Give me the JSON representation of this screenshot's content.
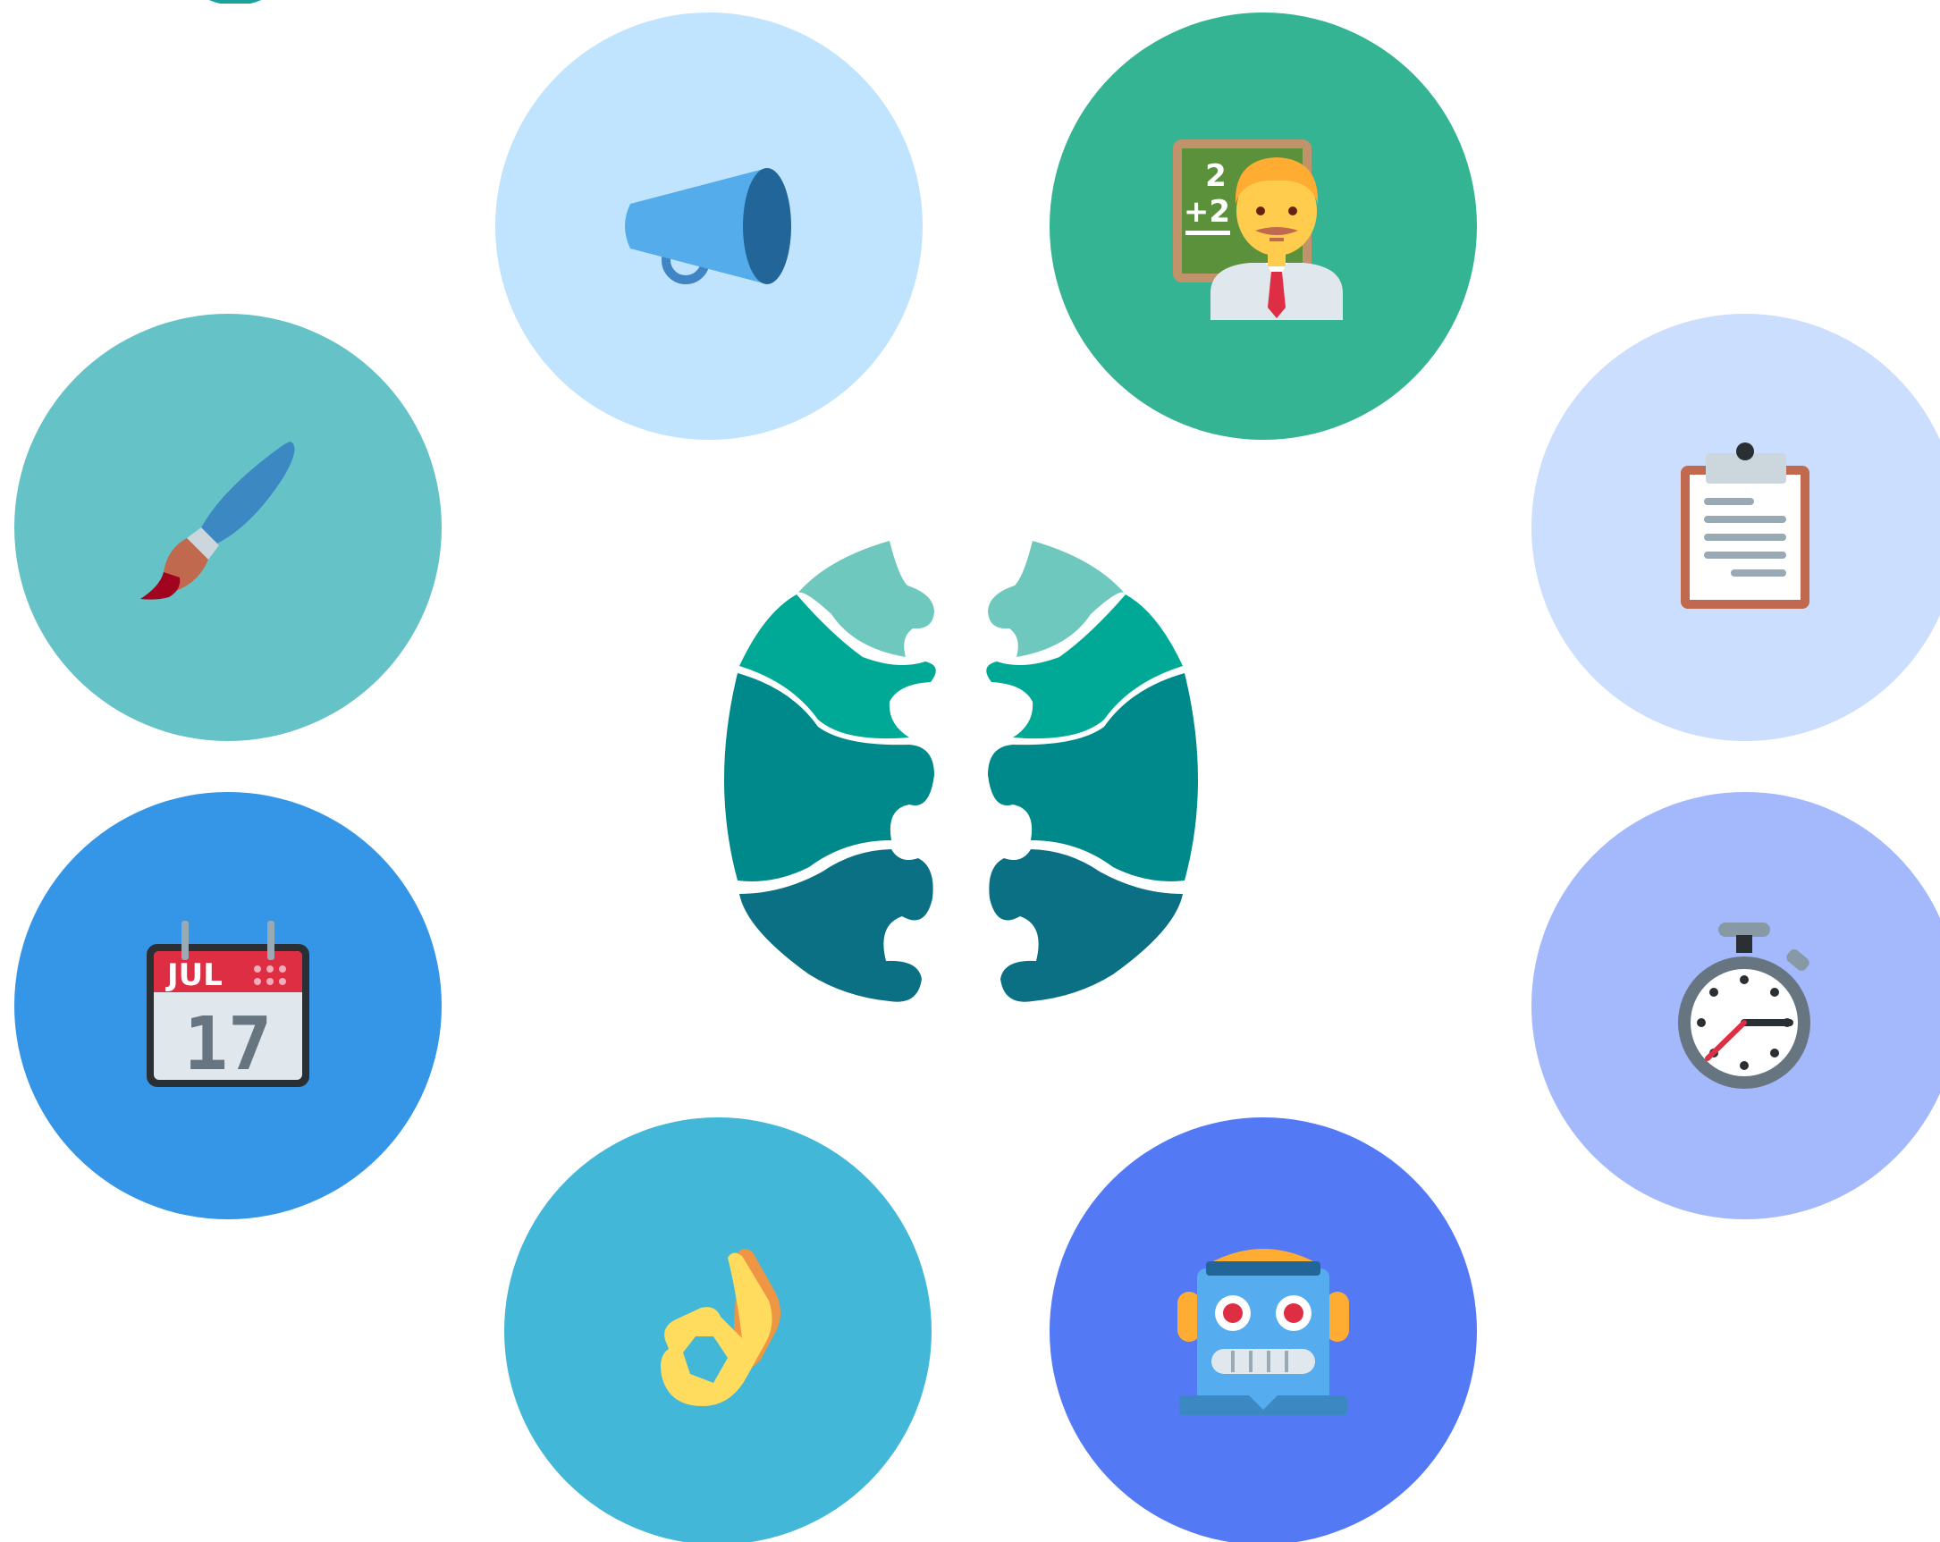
{
  "theme": {
    "background": "#ffffff",
    "brain_colors": [
      "#6ec8bd",
      "#00a996",
      "#00898a",
      "#0c7085"
    ]
  },
  "center_logo": {
    "icon": "puzzle-brain-icon"
  },
  "bubbles": [
    {
      "id": "megaphone",
      "icon": "megaphone-icon",
      "color": "#c0e3fe"
    },
    {
      "id": "teacher",
      "icon": "teacher-icon",
      "color": "#35b493"
    },
    {
      "id": "brush",
      "icon": "paintbrush-icon",
      "color": "#65c3c8"
    },
    {
      "id": "clipboard",
      "icon": "clipboard-icon",
      "color": "#ccdefd"
    },
    {
      "id": "calendar",
      "icon": "calendar-icon",
      "color": "#3596e7",
      "month": "JUL",
      "day": "17"
    },
    {
      "id": "stopwatch",
      "icon": "stopwatch-icon",
      "color": "#a4b9fc"
    },
    {
      "id": "ok",
      "icon": "ok-hand-icon",
      "color": "#42b7d7"
    },
    {
      "id": "robot",
      "icon": "robot-icon",
      "color": "#5479f5"
    }
  ],
  "teacher_board": {
    "line1": "2",
    "line2": "+2"
  }
}
